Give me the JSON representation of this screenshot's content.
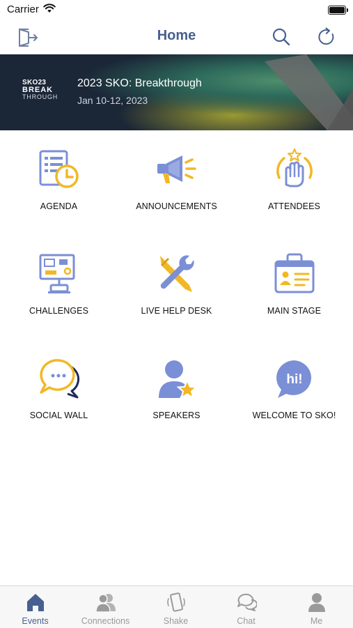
{
  "status_bar": {
    "carrier": "Carrier"
  },
  "nav": {
    "title": "Home"
  },
  "banner": {
    "logo_line1": "SKO23",
    "logo_line2": "BREAK",
    "logo_line3": "THROUGH",
    "event_title": "2023 SKO: Breakthrough",
    "event_date": "Jan 10-12, 2023"
  },
  "tiles": [
    {
      "label": "AGENDA",
      "icon": "agenda-icon"
    },
    {
      "label": "ANNOUNCEMENTS",
      "icon": "megaphone-icon"
    },
    {
      "label": "ATTENDEES",
      "icon": "raised-hand-icon"
    },
    {
      "label": "CHALLENGES",
      "icon": "game-board-icon"
    },
    {
      "label": "LIVE HELP DESK",
      "icon": "tools-icon"
    },
    {
      "label": "MAIN STAGE",
      "icon": "id-badge-icon"
    },
    {
      "label": "SOCIAL WALL",
      "icon": "chat-bubbles-icon"
    },
    {
      "label": "SPEAKERS",
      "icon": "star-person-icon"
    },
    {
      "label": "WELCOME TO SKO!",
      "icon": "hi-bubble-icon"
    }
  ],
  "hi_text": "hi!",
  "tabs": [
    {
      "label": "Events",
      "icon": "house-icon",
      "active": true
    },
    {
      "label": "Connections",
      "icon": "people-icon",
      "active": false
    },
    {
      "label": "Shake",
      "icon": "phone-shake-icon",
      "active": false
    },
    {
      "label": "Chat",
      "icon": "chat-icon",
      "active": false
    },
    {
      "label": "Me",
      "icon": "person-icon",
      "active": false
    }
  ],
  "colors": {
    "accent": "#47608f",
    "icon_blue": "#7b8fd6",
    "icon_gold": "#f2b824",
    "banner_bg": "#1b2637"
  }
}
